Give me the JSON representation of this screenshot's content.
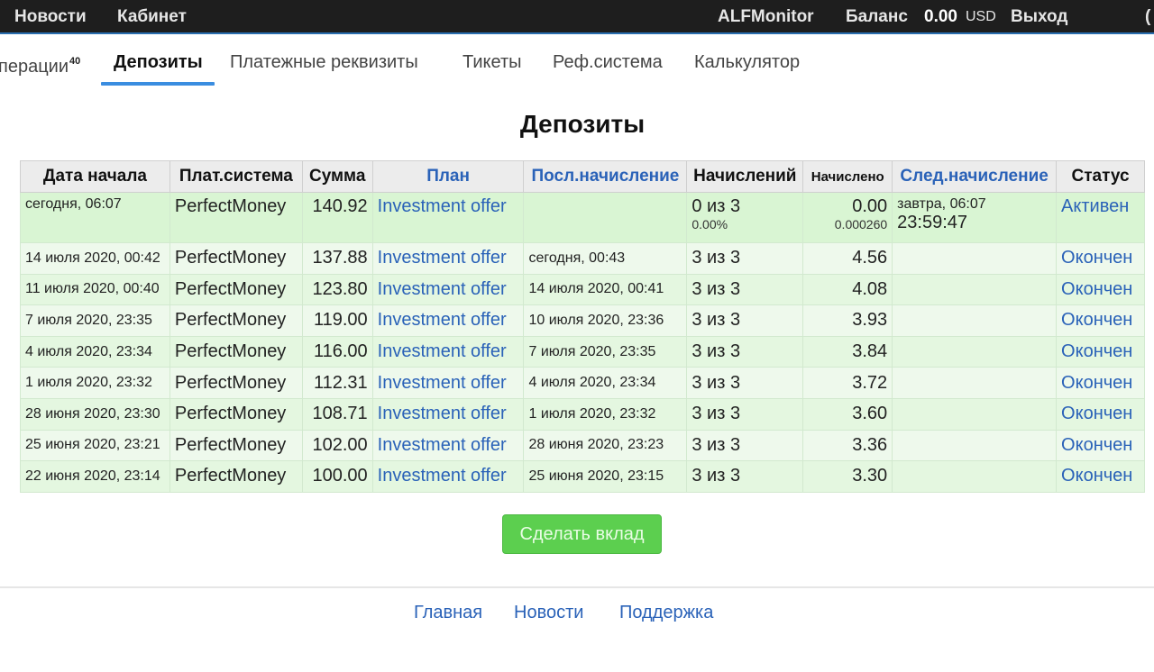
{
  "topbar": {
    "news": "Новости",
    "cabinet": "Кабинет",
    "brand": "ALFMonitor",
    "balance_label": "Баланс",
    "balance_amount": "0.00",
    "balance_currency": "USD",
    "logout": "Выход",
    "edge_fragment": "("
  },
  "tabs": {
    "operations_partial": "перации",
    "operations_count": "40",
    "deposits": "Депозиты",
    "payment_details": "Платежные реквизиты",
    "tickets": "Тикеты",
    "referral": "Реф.система",
    "calculator": "Калькулятор"
  },
  "page_title": "Депозиты",
  "table": {
    "headers": {
      "start_date": "Дата начала",
      "pay_system": "Плат.система",
      "amount": "Сумма",
      "plan": "План",
      "last_accrual": "Посл.начисление",
      "accruals": "Начислений",
      "accrued": "Начислено",
      "next_accrual": "След.начисление",
      "status": "Статус"
    },
    "first_row": {
      "start_date": "сегодня, 06:07",
      "pay_system": "PerfectMoney",
      "amount": "140.92",
      "plan": "Investment offer",
      "last_accrual": "",
      "accruals": "0 из 3",
      "accruals_percent": "0.00%",
      "accrued": "0.00",
      "accrued_sub": "0.000260",
      "next_accrual": "завтра, 06:07",
      "next_countdown": "23:59:47",
      "status": "Активен"
    },
    "rows": [
      {
        "start_date": "14 июля 2020, 00:42",
        "pay_system": "PerfectMoney",
        "amount": "137.88",
        "plan": "Investment offer",
        "last_accrual": "сегодня, 00:43",
        "accruals": "3 из 3",
        "accrued": "4.56",
        "status": "Окончен"
      },
      {
        "start_date": "11 июля 2020, 00:40",
        "pay_system": "PerfectMoney",
        "amount": "123.80",
        "plan": "Investment offer",
        "last_accrual": "14 июля 2020, 00:41",
        "accruals": "3 из 3",
        "accrued": "4.08",
        "status": "Окончен"
      },
      {
        "start_date": "7 июля 2020, 23:35",
        "pay_system": "PerfectMoney",
        "amount": "119.00",
        "plan": "Investment offer",
        "last_accrual": "10 июля 2020, 23:36",
        "accruals": "3 из 3",
        "accrued": "3.93",
        "status": "Окончен"
      },
      {
        "start_date": "4 июля 2020, 23:34",
        "pay_system": "PerfectMoney",
        "amount": "116.00",
        "plan": "Investment offer",
        "last_accrual": "7 июля 2020, 23:35",
        "accruals": "3 из 3",
        "accrued": "3.84",
        "status": "Окончен"
      },
      {
        "start_date": "1 июля 2020, 23:32",
        "pay_system": "PerfectMoney",
        "amount": "112.31",
        "plan": "Investment offer",
        "last_accrual": "4 июля 2020, 23:34",
        "accruals": "3 из 3",
        "accrued": "3.72",
        "status": "Окончен"
      },
      {
        "start_date": "28 июня 2020, 23:30",
        "pay_system": "PerfectMoney",
        "amount": "108.71",
        "plan": "Investment offer",
        "last_accrual": "1 июля 2020, 23:32",
        "accruals": "3 из 3",
        "accrued": "3.60",
        "status": "Окончен"
      },
      {
        "start_date": "25 июня 2020, 23:21",
        "pay_system": "PerfectMoney",
        "amount": "102.00",
        "plan": "Investment offer",
        "last_accrual": "28 июня 2020, 23:23",
        "accruals": "3 из 3",
        "accrued": "3.36",
        "status": "Окончен"
      },
      {
        "start_date": "22 июня 2020, 23:14",
        "pay_system": "PerfectMoney",
        "amount": "100.00",
        "plan": "Investment offer",
        "last_accrual": "25 июня 2020, 23:15",
        "accruals": "3 из 3",
        "accrued": "3.30",
        "status": "Окончен"
      }
    ]
  },
  "make_deposit_button": "Сделать вклад",
  "footer": {
    "home": "Главная",
    "news": "Новости",
    "support": "Поддержка"
  }
}
